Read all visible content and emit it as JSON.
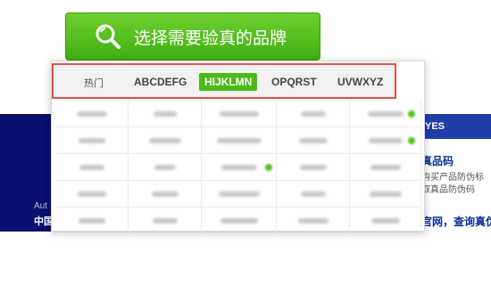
{
  "search_button": {
    "label": "选择需要验真的品牌"
  },
  "tabs": [
    {
      "label": "热门",
      "selected": false
    },
    {
      "label": "ABCDEFG",
      "selected": false
    },
    {
      "label": "HIJKLMN",
      "selected": true
    },
    {
      "label": "OPQRST",
      "selected": false
    },
    {
      "label": "UVWXYZ",
      "selected": false
    }
  ],
  "background": {
    "left_line_1": "Aut",
    "left_line_2": "中国",
    "right_header": "YES",
    "right_title": "真品码",
    "right_line_1": "购买产品防伪标",
    "right_line_2": "取真品防伪码",
    "right_title_2": "官网，查询真伪"
  },
  "colors": {
    "accent_green": "#4cbb19",
    "tab_border": "#e0524a",
    "navy": "#0b0f6e",
    "right_header_blue": "#1f3ea8"
  }
}
